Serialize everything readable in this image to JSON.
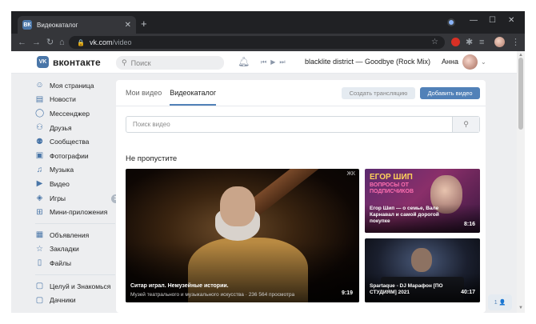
{
  "browser": {
    "tab_title": "Видеокаталог",
    "tab_favicon": "ВК",
    "url_host": "vk.com",
    "url_path": "/video"
  },
  "header": {
    "logo_text": "вконтакте",
    "logo_mark": "VK",
    "search_placeholder": "Поиск",
    "track": "blacklite district — Goodbye (Rock Mix)",
    "user_name": "Анна"
  },
  "sidebar": {
    "items": [
      {
        "label": "Моя страница",
        "icon": "home-icon",
        "glyph": "☺"
      },
      {
        "label": "Новости",
        "icon": "news-icon",
        "glyph": "▤"
      },
      {
        "label": "Мессенджер",
        "icon": "messenger-icon",
        "glyph": "◯"
      },
      {
        "label": "Друзья",
        "icon": "friends-icon",
        "glyph": "⚇"
      },
      {
        "label": "Сообщества",
        "icon": "communities-icon",
        "glyph": "⚉"
      },
      {
        "label": "Фотографии",
        "icon": "photos-icon",
        "glyph": "▣"
      },
      {
        "label": "Музыка",
        "icon": "music-icon",
        "glyph": "♫"
      },
      {
        "label": "Видео",
        "icon": "video-icon",
        "glyph": "▶"
      },
      {
        "label": "Игры",
        "icon": "games-icon",
        "glyph": "◈",
        "badge": "3"
      },
      {
        "label": "Мини-приложения",
        "icon": "mini-apps-icon",
        "glyph": "⊞"
      }
    ],
    "items2": [
      {
        "label": "Объявления",
        "icon": "ads-icon",
        "glyph": "▦"
      },
      {
        "label": "Закладки",
        "icon": "bookmarks-icon",
        "glyph": "☆"
      },
      {
        "label": "Файлы",
        "icon": "files-icon",
        "glyph": "▯"
      }
    ],
    "items3": [
      {
        "label": "Целуй и Знакомься",
        "icon": "app-icon",
        "glyph": "▢"
      },
      {
        "label": "Дачники",
        "icon": "app-icon",
        "glyph": "▢"
      }
    ]
  },
  "main": {
    "tabs": [
      "Мои видео",
      "Видеокаталог"
    ],
    "live_button": "Создать трансляцию",
    "add_button": "Добавить видео",
    "video_search_placeholder": "Поиск видео",
    "section_title": "Не пропустите",
    "videos": [
      {
        "title": "Ситар играл. Немузейные истории.",
        "channel": "Музей театрального и музыкального искусства",
        "views": "236 564 просмотра",
        "duration": "9:19"
      },
      {
        "overlay_title": "ЕГОР ШИП",
        "overlay_sub": "ВОПРОСЫ ОТ ПОДПИСЧИКОВ",
        "title": "Егор Шип — о семье, Вале Карнавал и самой дорогой покупке",
        "duration": "8:16"
      },
      {
        "title": "Spartaque - DJ Марафон [ПО СТУДИЯМ] 2021",
        "duration": "40:17"
      }
    ],
    "big_corner_logo": "ЖК"
  },
  "chat_button": "1 👤"
}
